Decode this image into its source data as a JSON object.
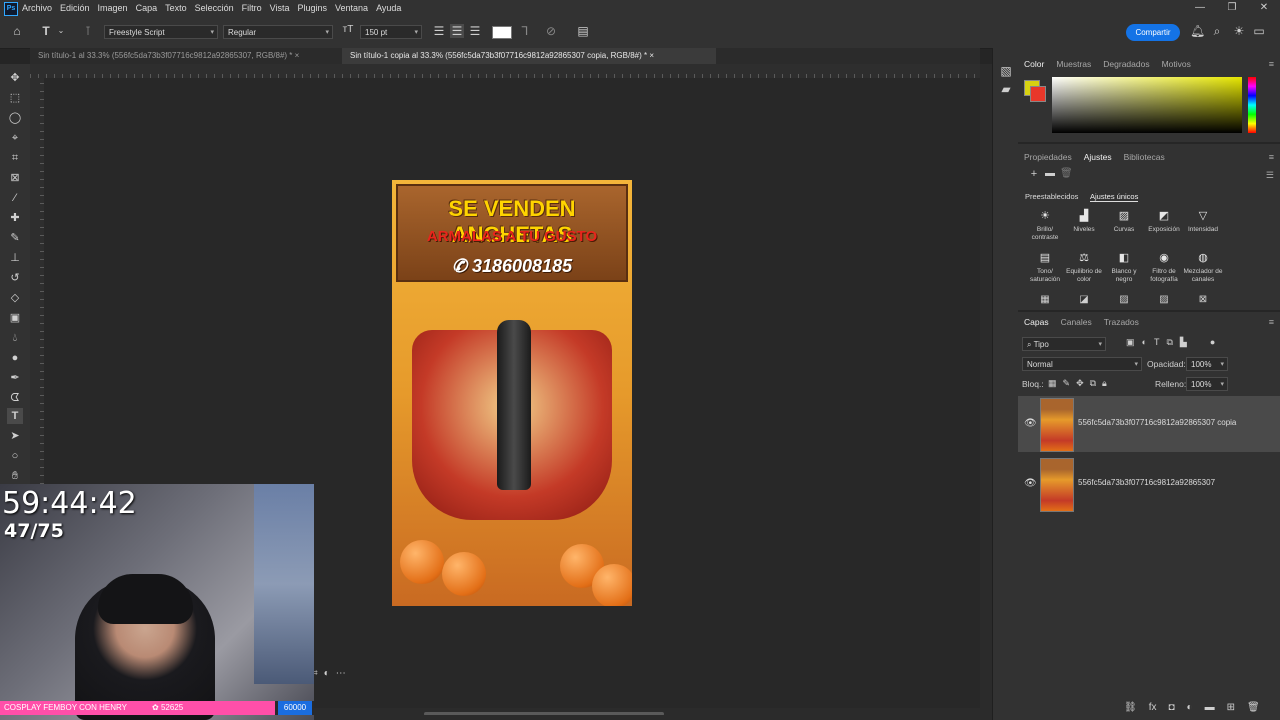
{
  "app": {
    "logo_text": "Ps",
    "menu": [
      "Archivo",
      "Edición",
      "Imagen",
      "Capa",
      "Texto",
      "Selección",
      "Filtro",
      "Vista",
      "Plugins",
      "Ventana",
      "Ayuda"
    ],
    "window_controls": [
      "—",
      "❐",
      "✕"
    ]
  },
  "options_bar": {
    "font_family": "Freestyle Script",
    "font_style": "Regular",
    "font_size": "150 pt",
    "share_label": "Compartir"
  },
  "tabs": [
    {
      "label": "Sin título-1 al 33.3% (556fc5da73b3f07716c9812a92865307, RGB/8#) *",
      "active": false
    },
    {
      "label": "Sin título-1 copia al 33.3% (556fc5da73b3f07716c9812a92865307 copia, RGB/8#) *",
      "active": true
    }
  ],
  "document": {
    "headline": "SE VENDEN ANCHETAS",
    "subheadline": "ARMALAS A TU GUSTO",
    "phone": "3186008185"
  },
  "color_panel": {
    "tabs": [
      "Color",
      "Muestras",
      "Degradados",
      "Motivos"
    ],
    "foreground": "#d7d211",
    "background": "#e8372a"
  },
  "adjustments_panel": {
    "tabs": [
      "Propiedades",
      "Ajustes",
      "Bibliotecas"
    ],
    "subtabs": [
      "Preestablecidos",
      "Ajustes únicos"
    ],
    "row1": [
      "Brillo/ contraste",
      "Niveles",
      "Curvas",
      "Exposición",
      "Intensidad"
    ],
    "row2": [
      "Tono/ saturación",
      "Equilibrio de color",
      "Blanco y negro",
      "Filtro de fotografía",
      "Mezclador de canales"
    ]
  },
  "layers_panel": {
    "tabs": [
      "Capas",
      "Canales",
      "Trazados"
    ],
    "filter": "Tipo",
    "blend_mode": "Normal",
    "opacity_label": "Opacidad:",
    "opacity_value": "100%",
    "lock_label": "Bloq.:",
    "fill_label": "Relleno:",
    "fill_value": "100%",
    "layers": [
      {
        "name": "556fc5da73b3f07716c9812a92865307 copia",
        "visible": true,
        "selected": true
      },
      {
        "name": "556fc5da73b3f07716c9812a92865307",
        "visible": true,
        "selected": false
      }
    ]
  },
  "stream_overlay": {
    "timer": "59:44:42",
    "counter": "47/75",
    "goal_label": "COSPLAY FEMBOY CON HENRY",
    "goal_current": "52625",
    "goal_target": "60000",
    "goal_progress": 0.877
  }
}
